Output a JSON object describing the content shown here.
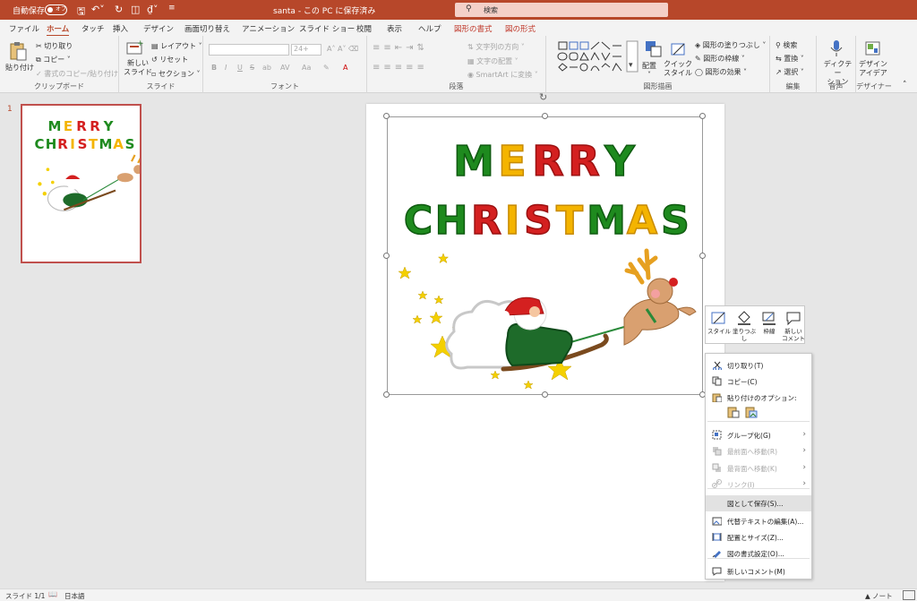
{
  "titlebar": {
    "autosave": "自動保存",
    "toggle": "オフ",
    "doc": "santa - この PC に保存済み",
    "search": "検索",
    "bg": "#b7472a"
  },
  "tabs": [
    "ファイル",
    "ホーム",
    "タッチ",
    "挿入",
    "デザイン",
    "画面切り替え",
    "アニメーション",
    "スライド ショー",
    "校閲",
    "表示",
    "ヘルプ",
    "図形の書式",
    "図の形式"
  ],
  "ribbon": {
    "clipboard": {
      "paste": "貼り付け",
      "cut": "切り取り",
      "copy": "コピー",
      "format_painter": "書式のコピー/貼り付け",
      "label": "クリップボード"
    },
    "slides": {
      "new_slide": "新しい\nスライド",
      "layout": "レイアウト",
      "reset": "リセット",
      "section": "セクション",
      "label": "スライド"
    },
    "font": {
      "size": "24+",
      "label": "フォント",
      "buttons": [
        "B",
        "I",
        "U",
        "S",
        "ab",
        "AV",
        "Aa",
        "A",
        "A"
      ]
    },
    "paragraph": {
      "text_direction": "文字列の方向",
      "align_text": "文字の配置",
      "smartart": "SmartArt に変換",
      "label": "段落"
    },
    "drawing": {
      "arrange": "配置",
      "quick_styles": "クイック\nスタイル",
      "fill": "図形の塗りつぶし",
      "outline": "図形の枠線",
      "effects": "図形の効果",
      "label": "図形描画"
    },
    "editing": {
      "find": "検索",
      "replace": "置換",
      "select": "選択",
      "label": "編集"
    },
    "voice": {
      "dictate": "ディクテー\nション",
      "label": "音声"
    },
    "designer": {
      "ideas": "デザイン\nアイデア",
      "label": "デザイナー"
    }
  },
  "thumbnail": {
    "number": "1"
  },
  "slide": {
    "line1": [
      "M",
      "E",
      "R",
      "R",
      "Y"
    ],
    "line2": [
      "C",
      "H",
      "R",
      "I",
      "S",
      "T",
      "M",
      "A",
      "S"
    ]
  },
  "minibar": {
    "items": [
      "スタイル",
      "塗りつぶし",
      "枠線",
      "新しい\nコメント"
    ]
  },
  "context_menu": {
    "items": [
      {
        "label": "切り取り(T)",
        "icon": "cut-icon",
        "disabled": false,
        "submenu": false
      },
      {
        "label": "コピー(C)",
        "icon": "copy-icon",
        "disabled": false,
        "submenu": false
      },
      {
        "label": "貼り付けのオプション:",
        "icon": "paste-icon",
        "disabled": false,
        "submenu": false
      },
      {
        "label": "グループ化(G)",
        "icon": "group-icon",
        "disabled": false,
        "submenu": true
      },
      {
        "label": "最前面へ移動(R)",
        "icon": "bring-front-icon",
        "disabled": true,
        "submenu": true
      },
      {
        "label": "最背面へ移動(K)",
        "icon": "send-back-icon",
        "disabled": true,
        "submenu": true
      },
      {
        "label": "リンク(I)",
        "icon": "link-icon",
        "disabled": true,
        "submenu": true
      },
      {
        "label": "図として保存(S)...",
        "icon": "",
        "disabled": false,
        "submenu": false
      },
      {
        "label": "代替テキストの編集(A)...",
        "icon": "alt-text-icon",
        "disabled": false,
        "submenu": false
      },
      {
        "label": "配置とサイズ(Z)...",
        "icon": "size-icon",
        "disabled": false,
        "submenu": false
      },
      {
        "label": "図の書式設定(O)...",
        "icon": "format-icon",
        "disabled": false,
        "submenu": false
      },
      {
        "label": "新しいコメント(M)",
        "icon": "comment-icon",
        "disabled": false,
        "submenu": false
      }
    ],
    "highlighted_index": 7
  },
  "status": {
    "slide": "スライド 1/1",
    "lang": "日本語",
    "notes": "ノート"
  },
  "colors": {
    "accent": "#b7472a",
    "green": "#1e8a1e",
    "red": "#d42020",
    "yellow": "#f4b400"
  }
}
